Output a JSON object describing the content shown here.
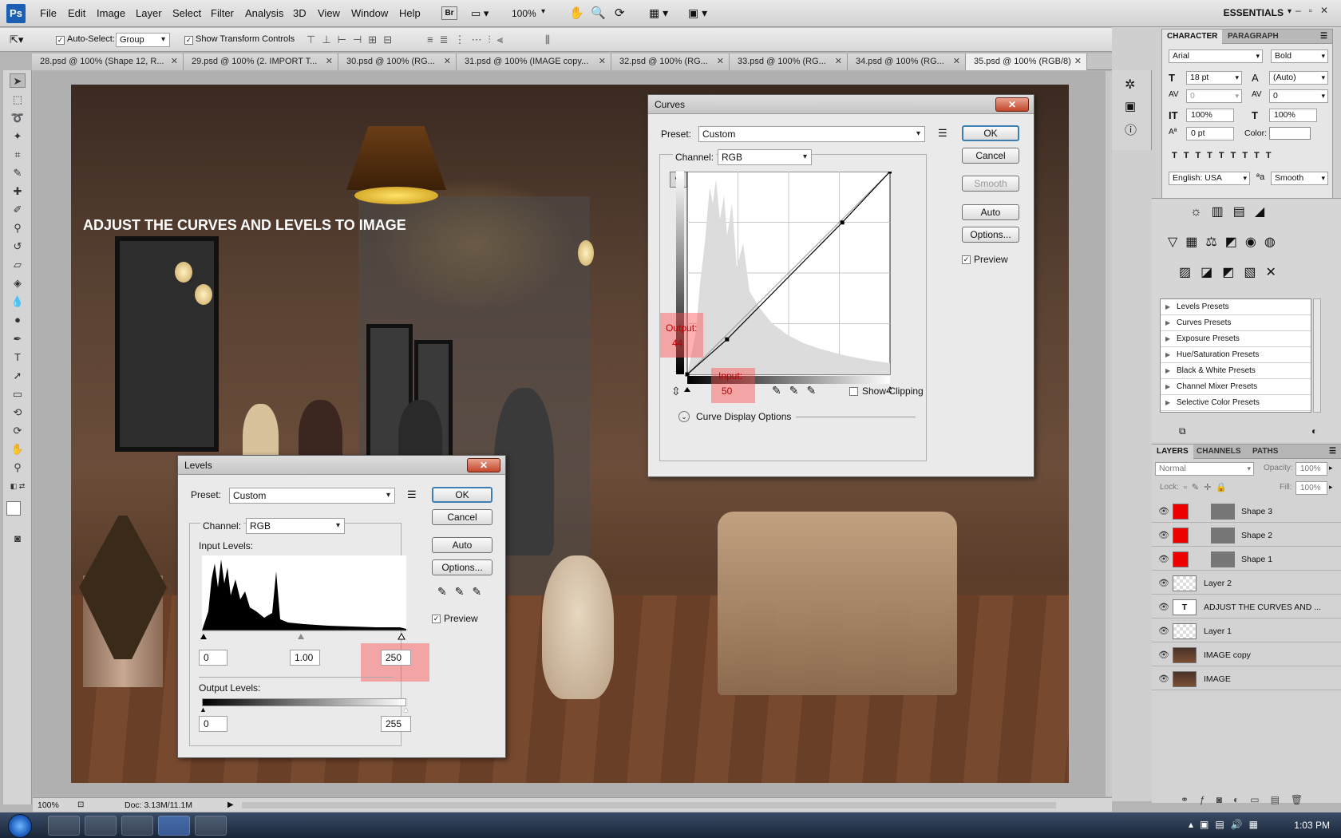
{
  "app": {
    "logo": "Ps"
  },
  "menu": [
    "File",
    "Edit",
    "Image",
    "Layer",
    "Select",
    "Filter",
    "Analysis",
    "3D",
    "View",
    "Window",
    "Help"
  ],
  "menubar_extras": {
    "bridge": "Br",
    "zoom": "100%",
    "workspace": "ESSENTIALS"
  },
  "options": {
    "auto_select_label": "Auto-Select:",
    "auto_select_value": "Group",
    "transform_label": "Show Transform Controls"
  },
  "tabs": [
    "28.psd @ 100% (Shape 12, R...",
    "29.psd @ 100% (2. IMPORT T...",
    "30.psd @ 100% (RG...",
    "31.psd @ 100% (IMAGE copy...",
    "32.psd @ 100% (RG...",
    "33.psd @ 100% (RG...",
    "34.psd @ 100% (RG...",
    "35.psd @ 100% (RGB/8)"
  ],
  "document": {
    "overlay_text": "ADJUST THE CURVES AND LEVELS TO IMAGE"
  },
  "curves": {
    "title": "Curves",
    "preset_label": "Preset:",
    "preset_value": "Custom",
    "channel_label": "Channel:",
    "channel_value": "RGB",
    "ok": "OK",
    "cancel": "Cancel",
    "smooth": "Smooth",
    "auto": "Auto",
    "options": "Options...",
    "preview_label": "Preview",
    "output_label": "Output:",
    "output_value": "44",
    "input_label": "Input:",
    "input_value": "50",
    "show_clipping": "Show Clipping",
    "display_options": "Curve Display Options",
    "curve_points": [
      [
        0,
        0
      ],
      [
        50,
        44
      ],
      [
        195,
        191
      ],
      [
        255,
        255
      ]
    ]
  },
  "levels": {
    "title": "Levels",
    "preset_label": "Preset:",
    "preset_value": "Custom",
    "channel_label": "Channel:",
    "channel_value": "RGB",
    "input_levels_label": "Input Levels:",
    "input_black": "0",
    "input_mid": "1.00",
    "input_white": "250",
    "output_levels_label": "Output Levels:",
    "output_black": "0",
    "output_white": "255",
    "ok": "OK",
    "cancel": "Cancel",
    "auto": "Auto",
    "options": "Options...",
    "preview_label": "Preview"
  },
  "character": {
    "tabs": [
      "CHARACTER",
      "PARAGRAPH"
    ],
    "font": "Arial",
    "style": "Bold",
    "size": "18 pt",
    "leading": "(Auto)",
    "kerning": "0",
    "tracking": "0",
    "vscale": "100%",
    "hscale": "100%",
    "baseline": "0 pt",
    "color_label": "Color:",
    "language": "English: USA",
    "antialias": "Smooth"
  },
  "adjustments": {
    "presets": [
      "Levels Presets",
      "Curves Presets",
      "Exposure Presets",
      "Hue/Saturation Presets",
      "Black & White Presets",
      "Channel Mixer Presets",
      "Selective Color Presets"
    ]
  },
  "layers": {
    "tabs": [
      "LAYERS",
      "CHANNELS",
      "PATHS"
    ],
    "blend": "Normal",
    "opacity_label": "Opacity:",
    "opacity": "100%",
    "lock_label": "Lock:",
    "fill_label": "Fill:",
    "fill": "100%",
    "items": [
      "Shape 3",
      "Shape 2",
      "Shape 1",
      "Layer 2",
      "ADJUST THE CURVES AND ...",
      "Layer 1",
      "IMAGE copy",
      "IMAGE"
    ]
  },
  "status": {
    "zoom": "100%",
    "doc": "Doc: 3.13M/11.1M"
  },
  "taskbar": {
    "time": "1:03 PM"
  }
}
